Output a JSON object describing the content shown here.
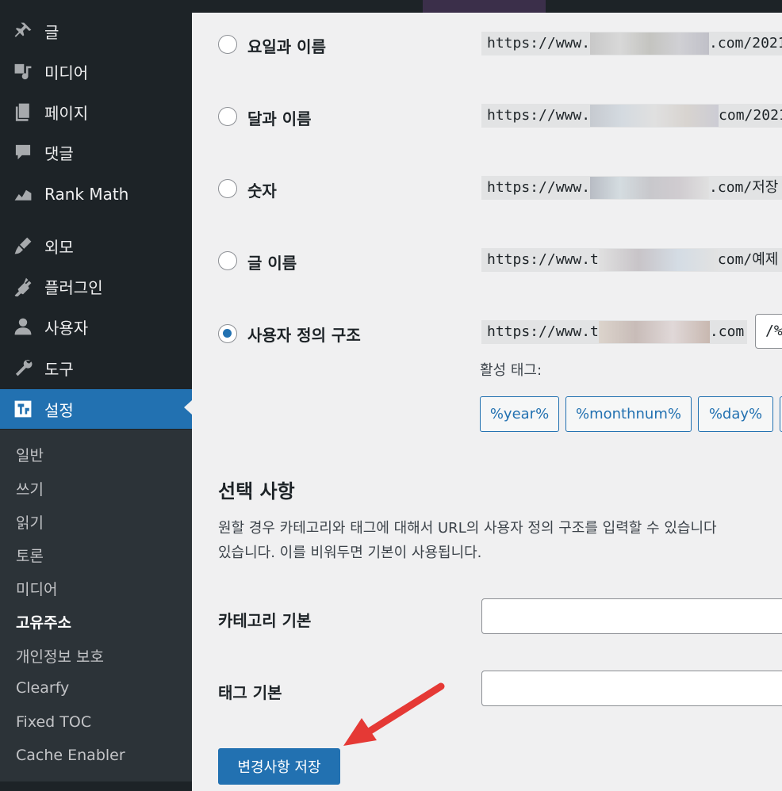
{
  "sidebar": {
    "items": [
      {
        "label": "글",
        "icon": "pin-icon"
      },
      {
        "label": "미디어",
        "icon": "media-icon"
      },
      {
        "label": "페이지",
        "icon": "page-icon"
      },
      {
        "label": "댓글",
        "icon": "comment-icon"
      },
      {
        "label": "Rank Math",
        "icon": "rank-math-icon"
      },
      {
        "label": "외모",
        "icon": "brush-icon"
      },
      {
        "label": "플러그인",
        "icon": "plugin-icon"
      },
      {
        "label": "사용자",
        "icon": "user-icon"
      },
      {
        "label": "도구",
        "icon": "wrench-icon"
      },
      {
        "label": "설정",
        "icon": "settings-icon"
      }
    ],
    "submenu": [
      "일반",
      "쓰기",
      "읽기",
      "토론",
      "미디어",
      "고유주소",
      "개인정보 보호",
      "Clearfy",
      "Fixed TOC",
      "Cache Enabler"
    ]
  },
  "permalink": {
    "options": [
      {
        "label": "요일과 이름",
        "prefix": "https://www.",
        "suffix": ".com/2021"
      },
      {
        "label": "달과 이름",
        "prefix": "https://www.",
        "suffix": "com/2021"
      },
      {
        "label": "숫자",
        "prefix": "https://www.",
        "suffix": ".com/저장"
      },
      {
        "label": "글 이름",
        "prefix": "https://www.t",
        "suffix": "com/예제"
      },
      {
        "label": "사용자 정의 구조",
        "prefix": "https://www.t",
        "suffix": ".com"
      }
    ],
    "custom_value": "/%",
    "tags_label": "활성 태그:",
    "tags": [
      "%year%",
      "%monthnum%",
      "%day%"
    ]
  },
  "optional": {
    "title": "선택 사항",
    "desc_line1": "원할 경우 카테고리와 태그에 대해서 URL의 사용자 정의 구조를 입력할 수 있습니다",
    "desc_line2": "있습니다. 이를 비워두면 기본이 사용됩니다.",
    "category_label": "카테고리 기본",
    "tag_label": "태그 기본",
    "category_value": "",
    "tag_value": ""
  },
  "save_label": "변경사항 저장",
  "colors": {
    "accent": "#2271b1",
    "sidebar": "#1d2327",
    "arrow": "#e53935"
  }
}
